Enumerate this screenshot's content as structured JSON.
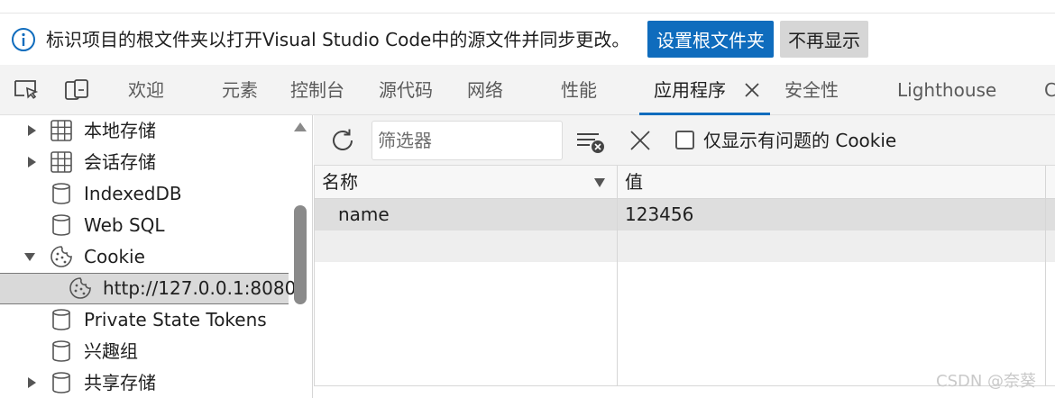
{
  "infobar": {
    "message": "标识项目的根文件夹以打开Visual Studio Code中的源文件并同步更改。",
    "primary_button": "设置根文件夹",
    "secondary_button": "不再显示"
  },
  "tabs": [
    {
      "label": "欢迎"
    },
    {
      "label": "元素"
    },
    {
      "label": "控制台"
    },
    {
      "label": "源代码"
    },
    {
      "label": "网络"
    },
    {
      "label": "性能"
    },
    {
      "label": "应用程序",
      "active": true
    },
    {
      "label": "安全性"
    },
    {
      "label": "Lighthouse"
    },
    {
      "label": "C"
    }
  ],
  "sidebar": {
    "items": [
      {
        "label": "本地存储",
        "icon": "grid-icon",
        "expandable": true
      },
      {
        "label": "会话存储",
        "icon": "grid-icon",
        "expandable": true
      },
      {
        "label": "IndexedDB",
        "icon": "database-icon"
      },
      {
        "label": "Web SQL",
        "icon": "database-icon"
      },
      {
        "label": "Cookie",
        "icon": "cookie-icon",
        "expanded": true
      },
      {
        "label": "http://127.0.0.1:8080",
        "icon": "cookie-icon",
        "selected": true
      },
      {
        "label": "Private State Tokens",
        "icon": "database-icon"
      },
      {
        "label": "兴趣组",
        "icon": "database-icon"
      },
      {
        "label": "共享存储",
        "icon": "database-icon",
        "expandable": true
      }
    ]
  },
  "toolbar": {
    "filter_placeholder": "筛选器",
    "only_issues_label": "仅显示有问题的 Cookie"
  },
  "table": {
    "columns": [
      "名称",
      "值"
    ],
    "rows": [
      {
        "name": "name",
        "value": "123456"
      }
    ]
  },
  "watermark": "CSDN @奈葵",
  "colors": {
    "accent": "#0f6cbd",
    "tabbar_bg": "#f3f3f3",
    "selected_row": "#d9d9d9"
  }
}
